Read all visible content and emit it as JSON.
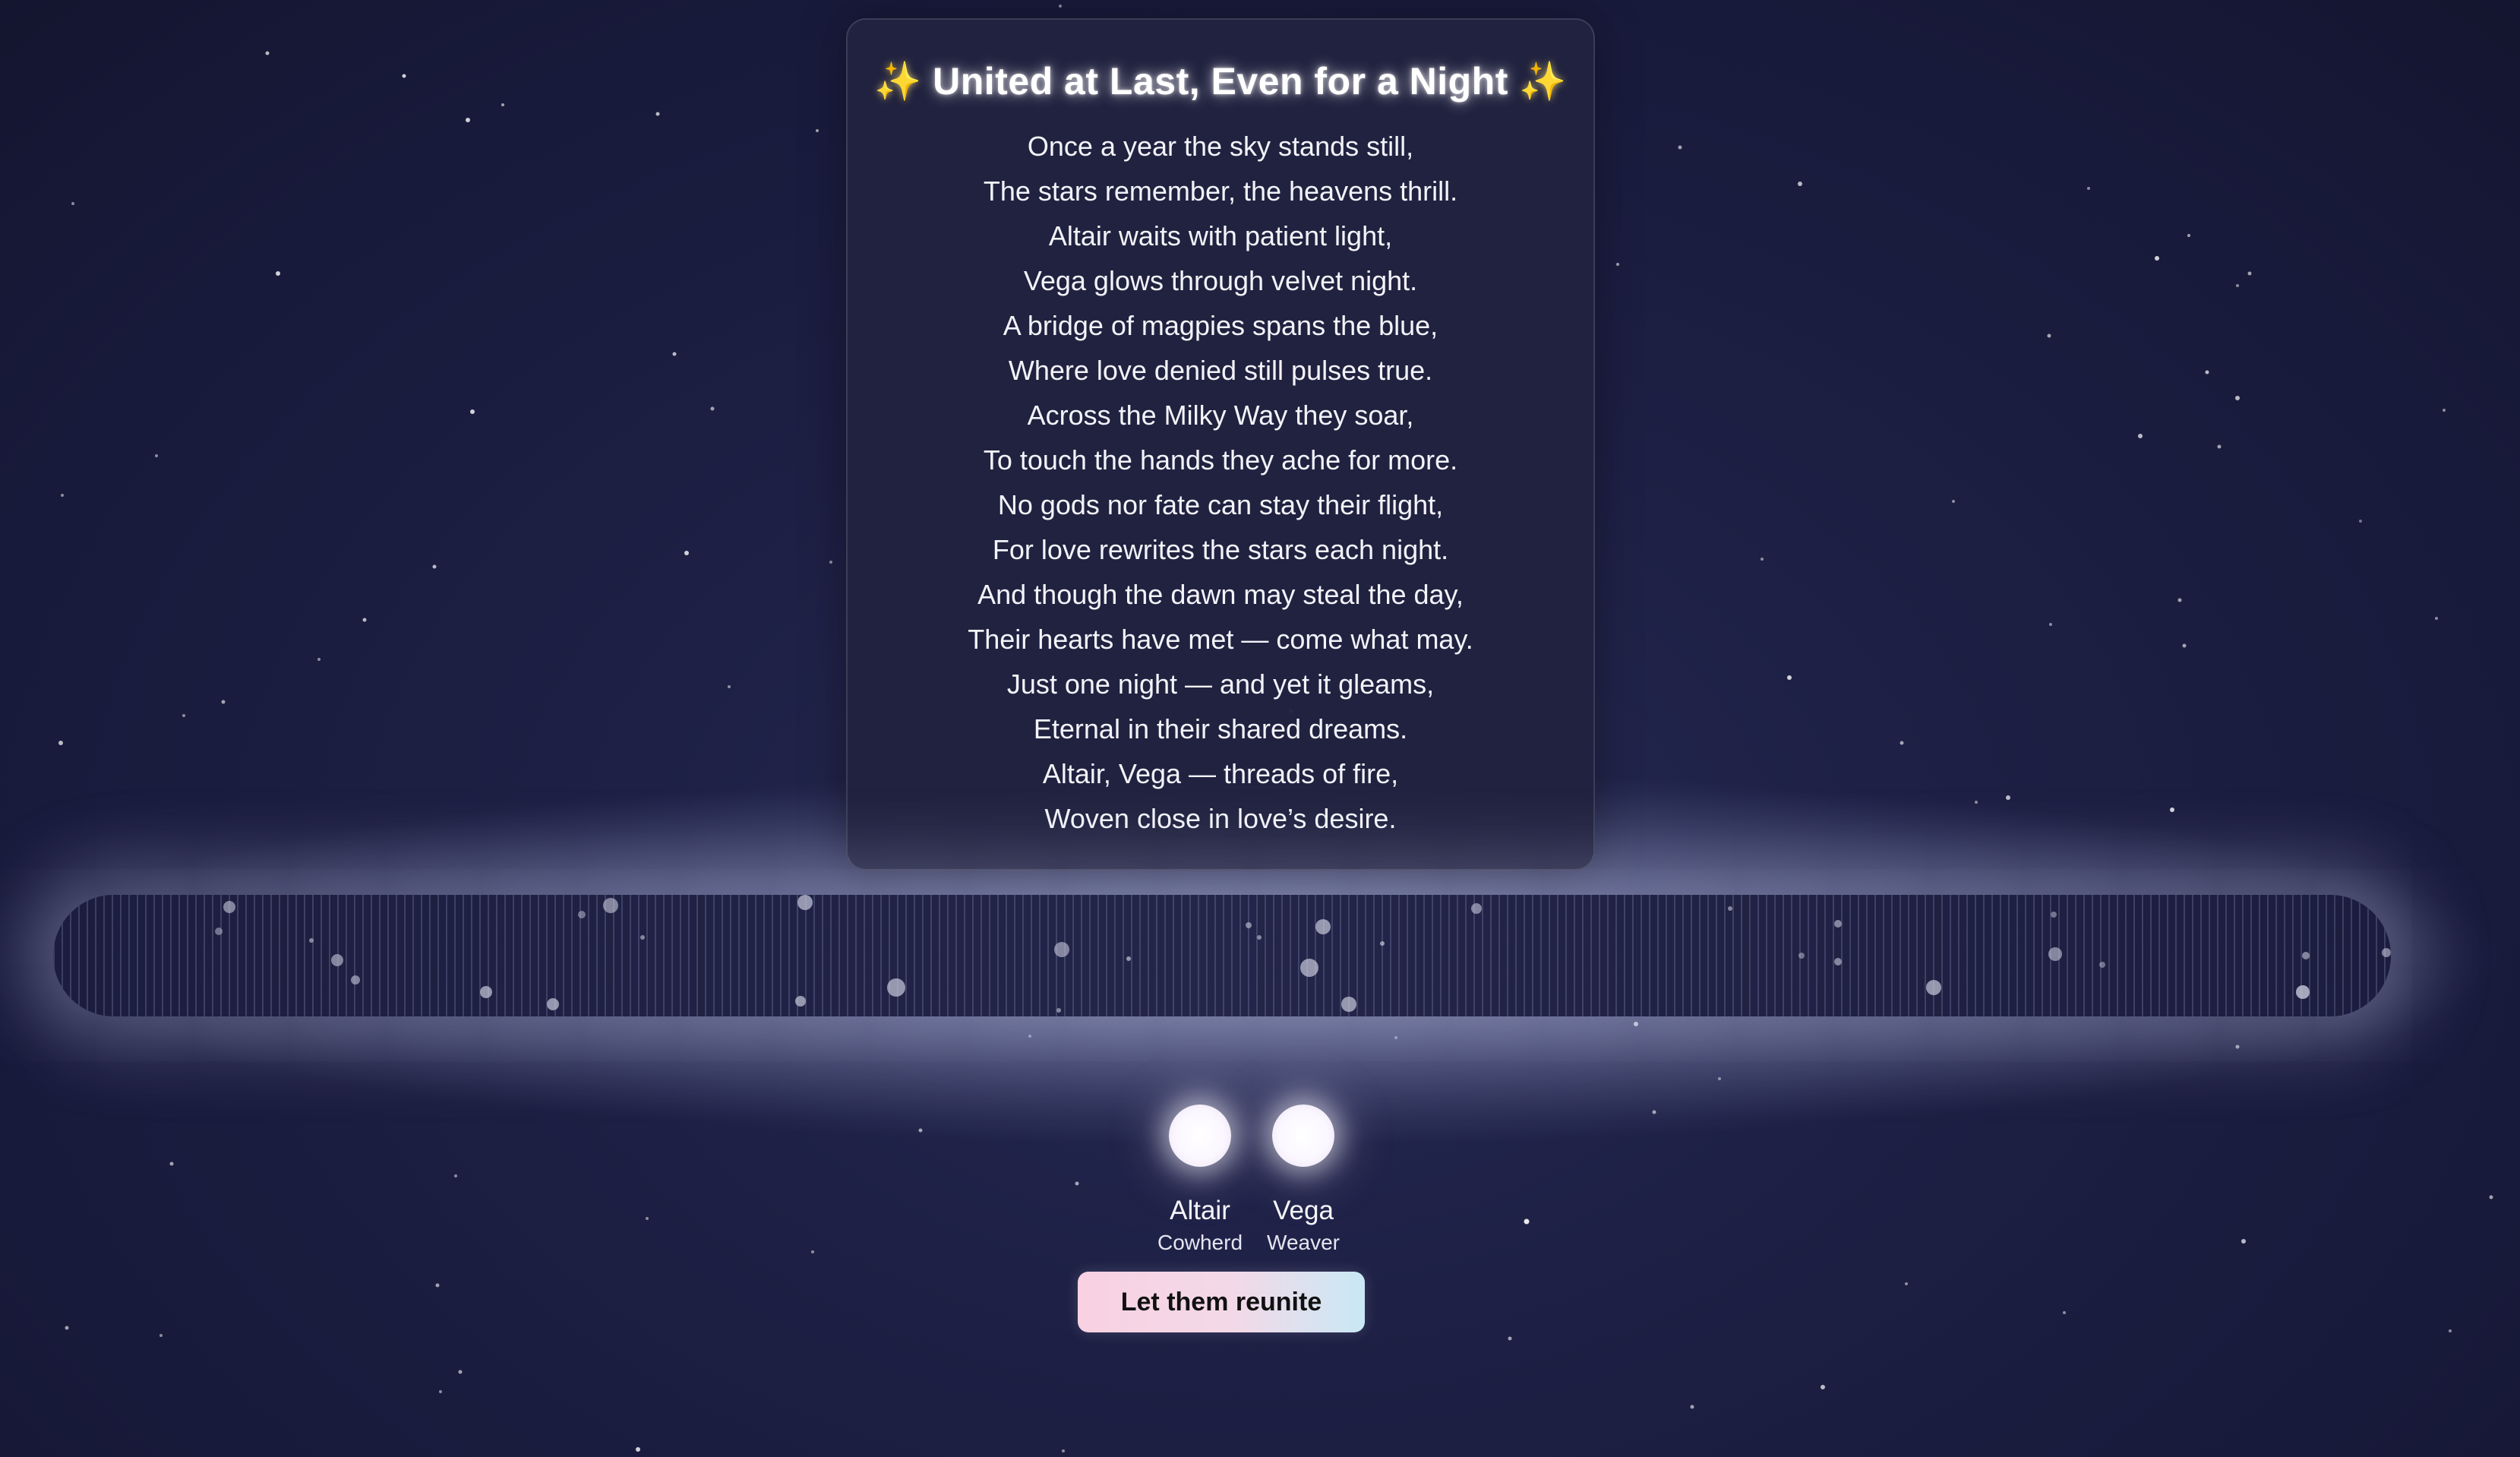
{
  "poem": {
    "title": "United at Last, Even for a Night",
    "sparkle_left": "✨",
    "sparkle_right": "✨",
    "lines": [
      "Once a year the sky stands still,",
      "The stars remember, the heavens thrill.",
      "Altair waits with patient light,",
      "Vega glows through velvet night.",
      "A bridge of magpies spans the blue,",
      "Where love denied still pulses true.",
      "Across the Milky Way they soar,",
      "To touch the hands they ache for more.",
      "No gods nor fate can stay their flight,",
      "For love rewrites the stars each night.",
      "And though the dawn may steal the day,",
      "Their hearts have met — come what may.",
      "Just one night — and yet it gleams,",
      "Eternal in their shared dreams.",
      "Altair, Vega — threads of fire,",
      "Woven close in love’s desire."
    ]
  },
  "stars": {
    "altair": {
      "name": "Altair",
      "role": "Cowherd"
    },
    "vega": {
      "name": "Vega",
      "role": "Weaver"
    }
  },
  "action": {
    "reunite_label": "Let them reunite"
  },
  "colors": {
    "background": "#1b1d42",
    "card": "#212240",
    "button_start": "#f8d1e2",
    "button_end": "#c9e8f5",
    "sparkle": "#f6dc6b"
  }
}
